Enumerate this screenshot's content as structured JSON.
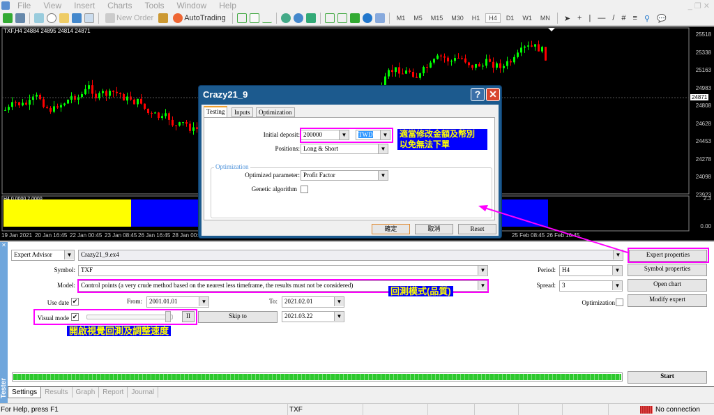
{
  "menu": [
    "File",
    "View",
    "Insert",
    "Charts",
    "Tools",
    "Window",
    "Help"
  ],
  "toolbar": {
    "new_order": "New Order",
    "autotrading": "AutoTrading",
    "timeframes": [
      "M1",
      "M5",
      "M15",
      "M30",
      "H1",
      "H4",
      "D1",
      "W1",
      "MN"
    ],
    "active_timeframe": "H4"
  },
  "chart": {
    "info": "TXF,H4  24884 24895 24814 24871",
    "current_price": "24871",
    "price_ticks": [
      "25518",
      "25338",
      "25163",
      "24983",
      "24808",
      "24628",
      "24453",
      "24278",
      "24098",
      "23923"
    ],
    "indicator_label": "H4 0.0000 2.0000",
    "indicator_ticks": [
      "2.3",
      "0.00"
    ],
    "time_ticks": [
      "19 Jan 2021",
      "20 Jan 16:45",
      "22 Jan 00:45",
      "23 Jan 08:45",
      "26 Jan 16:45",
      "28 Jan 00:45",
      "25 Feb 08:45",
      "26 Feb 16:45"
    ],
    "colors": {
      "bull": "#00ff00",
      "bear": "#ff0000",
      "ind1": "#ffff00",
      "ind2": "#0000ff"
    }
  },
  "dialog": {
    "title": "Crazy21_9",
    "tabs": [
      "Testing",
      "Inputs",
      "Optimization"
    ],
    "initial_deposit_label": "Initial deposit:",
    "initial_deposit": "200000",
    "currency": "TWD",
    "positions_label": "Positions:",
    "positions": "Long & Short",
    "optimization_group": "Optimization",
    "optimized_parameter_label": "Optimized parameter:",
    "optimized_parameter": "Profit Factor",
    "genetic_label": "Genetic algorithm",
    "genetic_checked": false,
    "ok": "確定",
    "cancel": "取消",
    "reset": "Reset",
    "note": [
      "適當修改金額及幣別",
      "以免無法下單"
    ]
  },
  "tester": {
    "type": "Expert Advisor",
    "expert": "Crazy21_9.ex4",
    "symbol_label": "Symbol:",
    "symbol": "TXF",
    "model_label": "Model:",
    "model": "Control points (a very crude method based on the nearest less timeframe, the results must not be considered)",
    "model_note": "回測模式(品質)",
    "use_date_label": "Use date",
    "use_date": true,
    "from_label": "From:",
    "from": "2001.01.01",
    "to_label": "To:",
    "to": "2021.02.01",
    "visual_label": "Visual mode",
    "visual": true,
    "speed_fraction": 0.97,
    "pause": "II",
    "skip_to": "Skip to",
    "skip_date": "2021.03.22",
    "visual_note": "開啟視覺回測及調整速度",
    "period_label": "Period:",
    "period": "H4",
    "spread_label": "Spread:",
    "spread": "3",
    "optimization_label": "Optimization",
    "optimization": false,
    "buttons": {
      "expert_properties": "Expert properties",
      "symbol_properties": "Symbol properties",
      "open_chart": "Open chart",
      "modify_expert": "Modify expert",
      "start": "Start"
    },
    "progress_percent": 100,
    "tabs": [
      "Settings",
      "Results",
      "Graph",
      "Report",
      "Journal"
    ],
    "strip_label": "Tester"
  },
  "status": {
    "help": "For Help, press F1",
    "symbol": "TXF",
    "connection": "No connection"
  }
}
